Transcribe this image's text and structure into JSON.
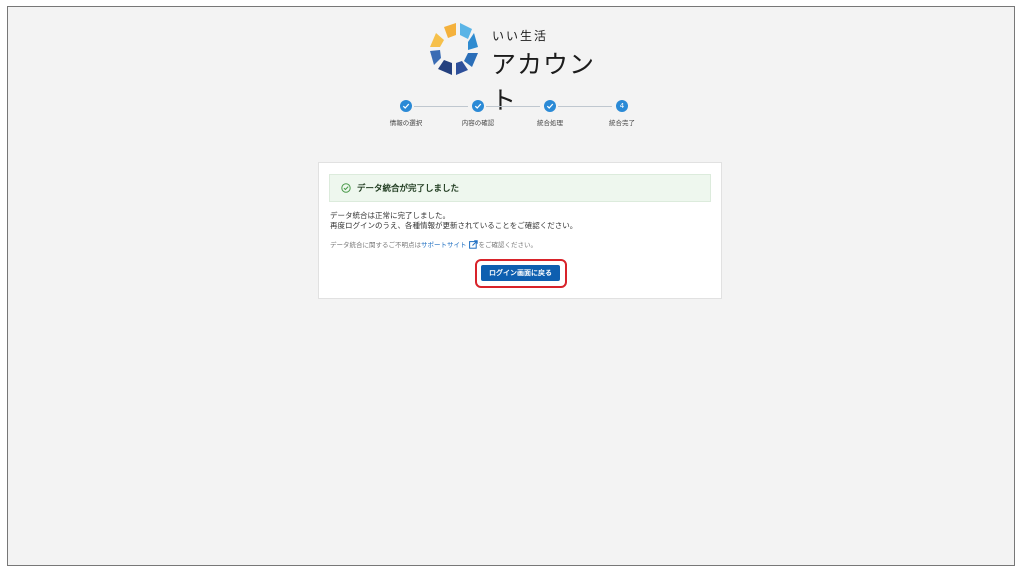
{
  "logo": {
    "small_text": "いい生活",
    "big_text": "アカウント"
  },
  "stepper": {
    "steps": [
      {
        "label": "情報の選択",
        "state": "done"
      },
      {
        "label": "内容の確認",
        "state": "done"
      },
      {
        "label": "統合処理",
        "state": "done"
      },
      {
        "label": "統合完了",
        "state": "current",
        "number": "4"
      }
    ],
    "accent_color": "#2b8ad6"
  },
  "card": {
    "banner_text": "データ統合が完了しました",
    "body_line1": "データ統合は正常に完了しました。",
    "body_line2": "再度ログインのうえ、各種情報が更新されていることをご確認ください。",
    "note_prefix": "データ統合に関するご不明点は",
    "note_link": "サポートサイト",
    "note_suffix": "をご確認ください。",
    "button_label": "ログイン画面に戻る"
  }
}
